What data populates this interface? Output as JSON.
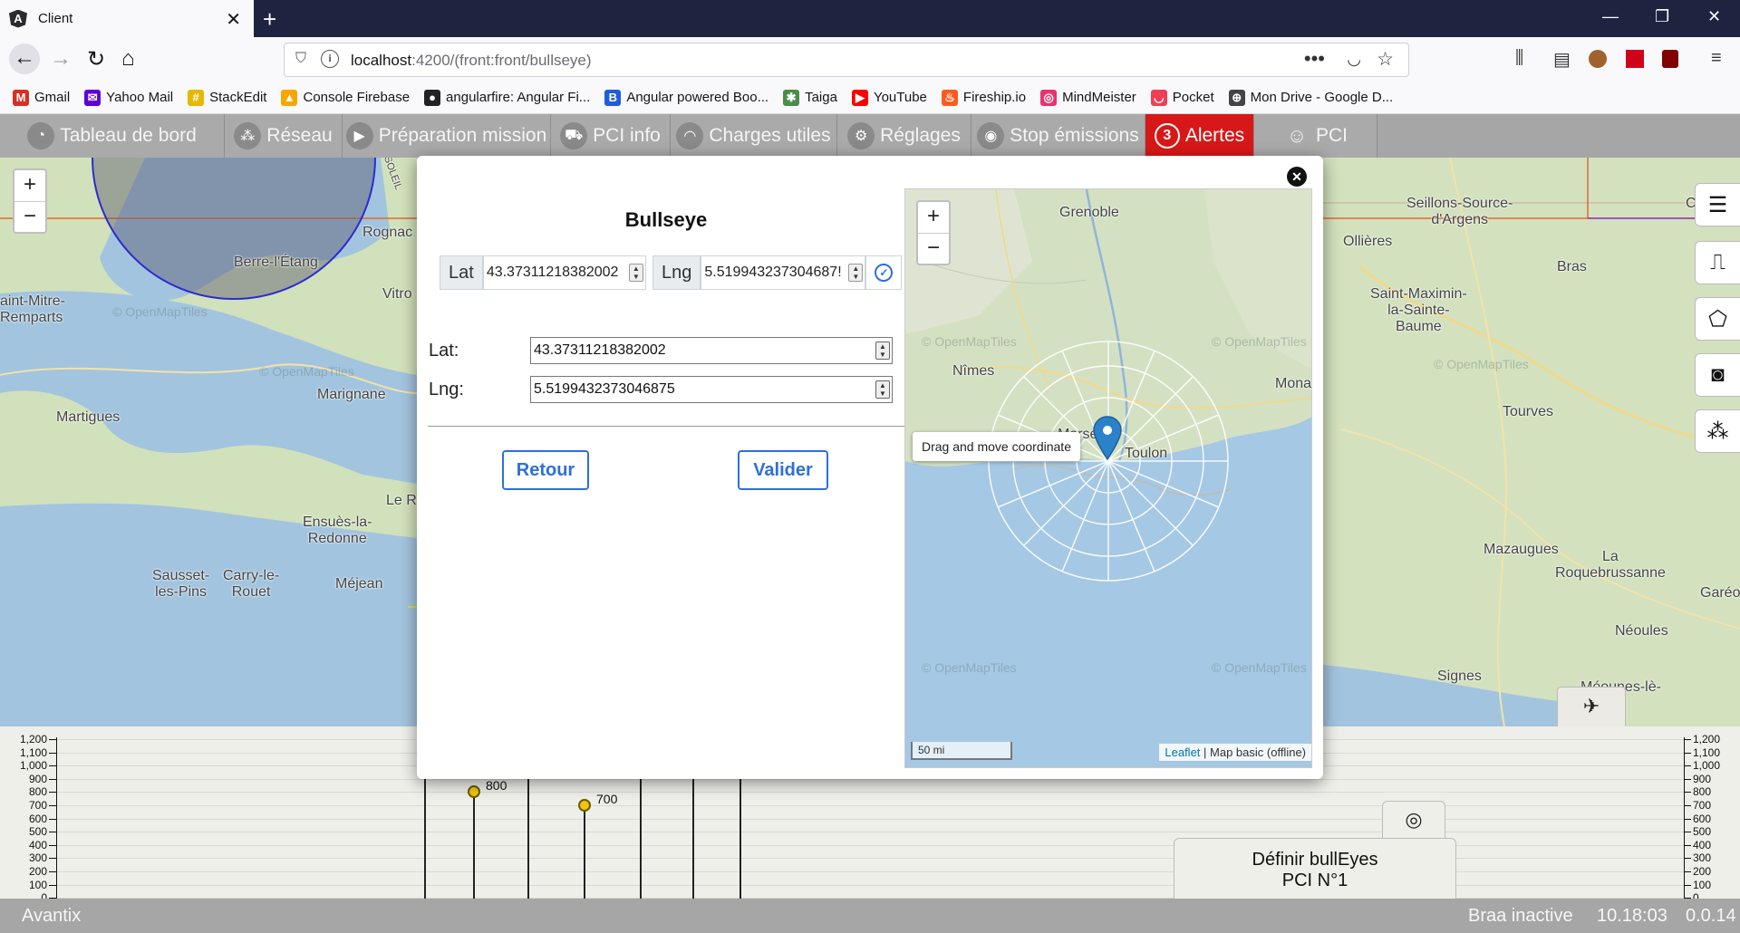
{
  "browser": {
    "tab_title": "Client",
    "url_host": "localhost",
    "url_path": ":4200/(front:front/bullseye)",
    "bookmarks": [
      {
        "label": "Gmail",
        "color": "#d93025",
        "glyph": "M"
      },
      {
        "label": "Yahoo Mail",
        "color": "#6001d2",
        "glyph": "✉"
      },
      {
        "label": "StackEdit",
        "color": "#e6b800",
        "glyph": "#"
      },
      {
        "label": "Console Firebase",
        "color": "#f6a700",
        "glyph": "▲"
      },
      {
        "label": "angularfire: Angular Fi...",
        "color": "#222",
        "glyph": "●"
      },
      {
        "label": "Angular powered Boo...",
        "color": "#1f5ed8",
        "glyph": "B"
      },
      {
        "label": "Taiga",
        "color": "#4c8c4a",
        "glyph": "✱"
      },
      {
        "label": "YouTube",
        "color": "#ff0000",
        "glyph": "▶"
      },
      {
        "label": "Fireship.io",
        "color": "#ff5a1f",
        "glyph": "♨"
      },
      {
        "label": "MindMeister",
        "color": "#e8336f",
        "glyph": "◎"
      },
      {
        "label": "Pocket",
        "color": "#ef3f56",
        "glyph": "◡"
      },
      {
        "label": "Mon Drive - Google D...",
        "color": "#444",
        "glyph": "⊕"
      }
    ]
  },
  "toolbar": {
    "items": [
      {
        "label": "Tableau de bord",
        "icon": "dashboard-icon",
        "glyph": "◔"
      },
      {
        "label": "Réseau",
        "icon": "network-icon",
        "glyph": "⁂"
      },
      {
        "label": "Préparation mission",
        "icon": "play-icon",
        "glyph": "▶"
      },
      {
        "label": "PCI info",
        "icon": "truck-icon",
        "glyph": "⛟"
      },
      {
        "label": "Charges utiles",
        "icon": "wifi-icon",
        "glyph": "◠"
      },
      {
        "label": "Réglages",
        "icon": "gears-icon",
        "glyph": "⚙"
      },
      {
        "label": "Stop émissions",
        "icon": "stop-icon",
        "glyph": "◉"
      },
      {
        "label": "Alertes",
        "icon": "alert-count-icon",
        "glyph": "3"
      },
      {
        "label": "PCI",
        "icon": "user-icon",
        "glyph": "☺"
      }
    ]
  },
  "background_map": {
    "labels": [
      "Berre-l'Étang",
      "Rognac",
      "Vitro",
      "aint-Mitre-\nRemparts",
      "Martigues",
      "Marignane",
      "Le R",
      "Ensuès-la-\nRedonne",
      "Sausset-\nles-Pins",
      "Carry-le-\nRouet",
      "Méjean",
      "SOLEIL",
      "Seillons-Source-\nd'Argens",
      "Châte",
      "Ollières",
      "Bras",
      "Saint-Maximin-\nla-Sainte-\nBaume",
      "Tourves",
      "Mazaugues",
      "La\nRoquebrussanne",
      "Garéo",
      "Néoules",
      "Signes",
      "Méounes-lè-\nx"
    ],
    "watermark": "© OpenMapTiles"
  },
  "map_controls": {
    "zoom_in": "+",
    "zoom_out": "−"
  },
  "modal": {
    "title": "Bullseye",
    "lat_label": "Lat",
    "lng_label": "Lng",
    "lat_value": "43.37311218382002",
    "lng_value": "5.519943237304687!",
    "form_lat_label": "Lat:",
    "form_lng_label": "Lng:",
    "form_lat_value": "43.37311218382002",
    "form_lng_value": "5.5199432373046875",
    "back_button": "Retour",
    "validate_button": "Valider",
    "close_glyph": "✕"
  },
  "mini_map": {
    "labels": [
      "Grenoble",
      "Nîmes",
      "Mona",
      "Marseille",
      "Toulon"
    ],
    "tooltip": "Drag and move coordinate",
    "scale": "50 mi",
    "attribution_link": "Leaflet",
    "attribution_text": " | Map basic (offline)",
    "watermark": "© OpenMapTiles"
  },
  "altitude_chart": {
    "ticks": [
      "1,200",
      "1,100",
      "1,000",
      "900",
      "800",
      "700",
      "600",
      "500",
      "400",
      "300",
      "200",
      "100",
      "0"
    ],
    "points": [
      {
        "label": "800",
        "value": 800
      },
      {
        "label": "700",
        "value": 700
      }
    ]
  },
  "bullseye_button": {
    "line1": "Définir bullEyes",
    "line2": "PCI N°1"
  },
  "statusbar": {
    "app_name": "Avantix",
    "braa": "Braa inactive",
    "time": "10.18:03",
    "version": "0.0.14"
  }
}
